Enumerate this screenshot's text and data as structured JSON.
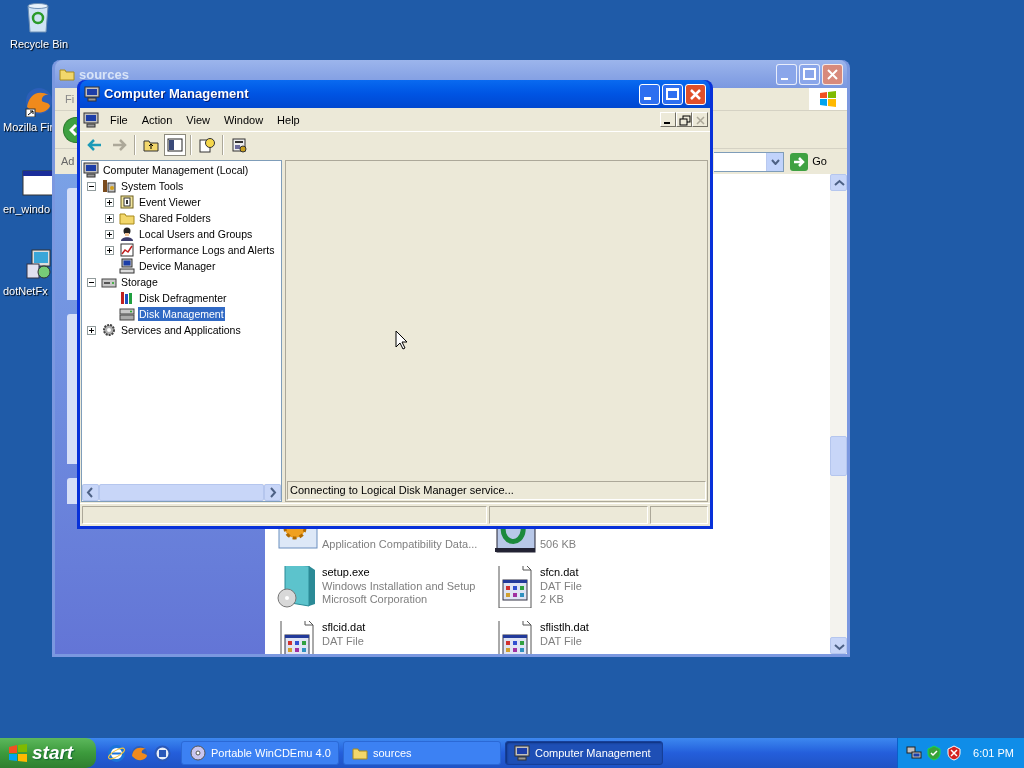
{
  "desktop_icons": [
    {
      "kind": "recycle_bin",
      "label": "Recycle Bin"
    },
    {
      "kind": "browser",
      "label": "Mozilla Fir"
    },
    {
      "kind": "window",
      "label": "en_windo"
    },
    {
      "kind": "installer",
      "label": "dotNetFx"
    }
  ],
  "explorer": {
    "title": "sources",
    "menu": "Fi",
    "address_label": "Ad",
    "go": "Go",
    "files": [
      {
        "kind": "app",
        "details": [
          "Application Compatibility Data..."
        ]
      },
      {
        "kind": "font",
        "details": [
          "506 KB"
        ]
      },
      {
        "kind": "setup",
        "name": "setup.exe",
        "details": [
          "Windows Installation and Setup",
          "Microsoft Corporation"
        ]
      },
      {
        "kind": "dat",
        "name": "sfcn.dat",
        "details": [
          "DAT File",
          "2 KB"
        ]
      },
      {
        "kind": "dat",
        "name": "sflcid.dat",
        "details": [
          "DAT File"
        ]
      },
      {
        "kind": "dat",
        "name": "sflistlh.dat",
        "details": [
          "DAT File"
        ]
      }
    ]
  },
  "computer_management": {
    "title": "Computer Management",
    "menu": [
      "File",
      "Action",
      "View",
      "Window",
      "Help"
    ],
    "tree": [
      {
        "kind": "computer",
        "label": "Computer Management (Local)",
        "selected": false,
        "children": [
          {
            "kind": "tools",
            "label": "System Tools",
            "expanded": true,
            "selected": false,
            "children": [
              {
                "kind": "event",
                "label": "Event Viewer",
                "expanded": false,
                "selected": false
              },
              {
                "kind": "folder",
                "label": "Shared Folders",
                "expanded": false,
                "selected": false
              },
              {
                "kind": "users",
                "label": "Local Users and Groups",
                "expanded": false,
                "selected": false
              },
              {
                "kind": "perf",
                "label": "Performance Logs and Alerts",
                "expanded": false,
                "selected": false
              },
              {
                "kind": "device",
                "label": "Device Manager",
                "selected": false
              }
            ]
          },
          {
            "kind": "storage",
            "label": "Storage",
            "expanded": true,
            "selected": false,
            "children": [
              {
                "kind": "defrag",
                "label": "Disk Defragmenter",
                "selected": false
              },
              {
                "kind": "disk",
                "label": "Disk Management",
                "selected": true
              }
            ]
          },
          {
            "kind": "services",
            "label": "Services and Applications",
            "expanded": false,
            "selected": false
          }
        ]
      }
    ],
    "status_message": "Connecting to Logical Disk Manager service..."
  },
  "taskbar": {
    "start": "start",
    "tasks": [
      {
        "kind": "disc",
        "label": "Portable WinCDEmu 4.0",
        "selected": false
      },
      {
        "kind": "folder",
        "label": "sources",
        "selected": false
      },
      {
        "kind": "computer",
        "label": "Computer Management",
        "selected": true
      }
    ],
    "clock": "6:01 PM"
  }
}
